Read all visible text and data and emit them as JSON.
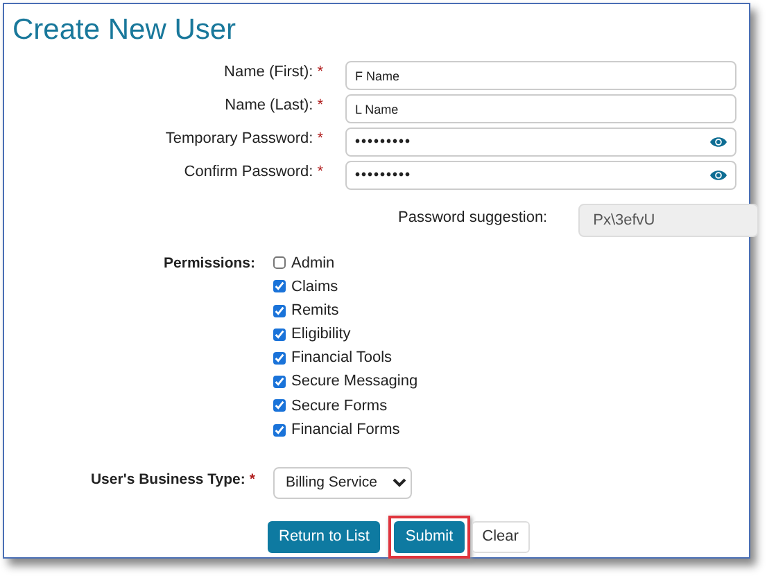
{
  "title": "Create New User",
  "fields": [
    {
      "label": "Name (First):",
      "required_mark": "*",
      "value": "F Name",
      "kind": "text"
    },
    {
      "label": "Name (Last):",
      "required_mark": "*",
      "value": "L Name",
      "kind": "text"
    },
    {
      "label": "Temporary Password:",
      "required_mark": "*",
      "value": "•••••••••",
      "kind": "password"
    },
    {
      "label": "Confirm Password:",
      "required_mark": "*",
      "value": "•••••••••",
      "kind": "password"
    }
  ],
  "suggestion": {
    "label": "Password suggestion:",
    "value": "Px\\3efvU"
  },
  "permissions": {
    "label": "Permissions:",
    "items": [
      {
        "label": "Admin",
        "checked": false
      },
      {
        "label": "Claims",
        "checked": true
      },
      {
        "label": "Remits",
        "checked": true
      },
      {
        "label": "Eligibility",
        "checked": true
      },
      {
        "label": "Financial Tools",
        "checked": true
      },
      {
        "label": "Secure Messaging",
        "checked": true
      },
      {
        "label": "Secure Forms",
        "checked": true
      },
      {
        "label": "Financial Forms",
        "checked": true
      }
    ]
  },
  "business_type": {
    "label": "User's Business Type:",
    "required_mark": "*",
    "value": "Billing Service"
  },
  "buttons": [
    {
      "label": "Return to List",
      "kind": "primary",
      "highlighted": false
    },
    {
      "label": "Submit",
      "kind": "primary",
      "highlighted": true
    },
    {
      "label": "Clear",
      "kind": "plain",
      "highlighted": false
    }
  ]
}
